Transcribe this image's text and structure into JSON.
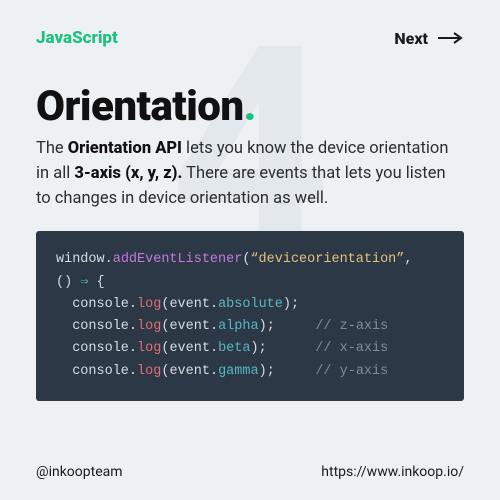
{
  "bg_number": "4",
  "header": {
    "brand": "JavaScript",
    "next_label": "Next"
  },
  "title": "Orientation",
  "title_dot": ".",
  "desc": {
    "pre": "The ",
    "bold1": "Orientation API",
    "mid1": " lets you know the device orientation in all ",
    "bold2": "3-axis (x, y, z).",
    "post": " There are events that lets you listen to changes in device orientation as well."
  },
  "code": {
    "l1": {
      "obj": "window",
      "dot": ".",
      "method": "addEventListener",
      "paren": "(",
      "str": "“deviceorientation”",
      "comma": ","
    },
    "l2": {
      "parens": "() ",
      "arrow": "⇒",
      "brace": " {"
    },
    "l3": {
      "indent": "  ",
      "obj": "console",
      "dot": ".",
      "fn": "log",
      "open": "(",
      "evt": "event",
      "dot2": ".",
      "prop": "absolute",
      "close": ");"
    },
    "l4": {
      "indent": "  ",
      "obj": "console",
      "dot": ".",
      "fn": "log",
      "open": "(",
      "evt": "event",
      "dot2": ".",
      "prop": "alpha",
      "close": ");",
      "pad": "     ",
      "comment": "// z-axis"
    },
    "l5": {
      "indent": "  ",
      "obj": "console",
      "dot": ".",
      "fn": "log",
      "open": "(",
      "evt": "event",
      "dot2": ".",
      "prop": "beta",
      "close": ");",
      "pad": "      ",
      "comment": "// x-axis"
    },
    "l6": {
      "indent": "  ",
      "obj": "console",
      "dot": ".",
      "fn": "log",
      "open": "(",
      "evt": "event",
      "dot2": ".",
      "prop": "gamma",
      "close": ");",
      "pad": "     ",
      "comment": "// y-axis"
    }
  },
  "footer": {
    "handle": "@inkoopteam",
    "url": "https://www.inkoop.io/"
  },
  "colors": {
    "accent": "#18c27a",
    "code_bg": "#2d3846"
  }
}
